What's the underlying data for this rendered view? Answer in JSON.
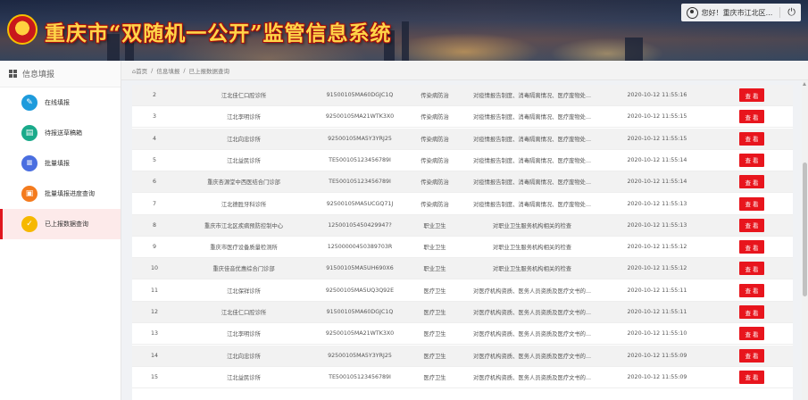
{
  "header": {
    "title": "重庆市“双随机一公开”监管信息系统",
    "user_greeting": "您好！重庆市江北区...",
    "user_icon": "user-icon",
    "logout_icon": "power-icon"
  },
  "sidebar": {
    "heading": "信息填报",
    "items": [
      {
        "label": "在线填报",
        "icon": "edit-icon",
        "color": "#1e9bdc"
      },
      {
        "label": "待报送草稿箱",
        "icon": "draft-icon",
        "color": "#1aaa8a"
      },
      {
        "label": "批量填报",
        "icon": "batch-icon",
        "color": "#4a6ee0"
      },
      {
        "label": "批量填报进度查询",
        "icon": "progress-icon",
        "color": "#f47b1e"
      },
      {
        "label": "已上报数据查询",
        "icon": "query-icon",
        "color": "#f6b800",
        "active": true
      }
    ]
  },
  "breadcrumb": [
    "⌂首页",
    "/",
    "信息填报",
    "/",
    "已上报数据查询"
  ],
  "table": {
    "view_label": "查 看",
    "rows": [
      {
        "no": "2",
        "name": "江北佳仁口腔诊所",
        "code": "91500105MA60DGJC1Q",
        "category": "传染病防治",
        "desc": "对疫情报告制度、消毒隔离情况、医疗废物处...",
        "time": "2020-10-12 11:55:16"
      },
      {
        "no": "3",
        "name": "江北李明诊所",
        "code": "92500105MA21WTK3X0",
        "category": "传染病防治",
        "desc": "对疫情报告制度、消毒隔离情况、医疗废物处...",
        "time": "2020-10-12 11:55:15"
      },
      {
        "no": "4",
        "name": "江北向忠诊所",
        "code": "92500105MA5Y3YRJ25",
        "category": "传染病防治",
        "desc": "对疫情报告制度、消毒隔离情况、医疗废物处...",
        "time": "2020-10-12 11:55:15"
      },
      {
        "no": "5",
        "name": "江北益民诊所",
        "code": "TE500105123456789I",
        "category": "传染病防治",
        "desc": "对疫情报告制度、消毒隔离情况、医疗废物处...",
        "time": "2020-10-12 11:55:14"
      },
      {
        "no": "6",
        "name": "重庆杏源堂中西医结合门诊部",
        "code": "TE500105123456789I",
        "category": "传染病防治",
        "desc": "对疫情报告制度、消毒隔离情况、医疗废物处...",
        "time": "2020-10-12 11:55:14"
      },
      {
        "no": "7",
        "name": "江北德胜牙科诊所",
        "code": "92500105MA5UCGQ71J",
        "category": "传染病防治",
        "desc": "对疫情报告制度、消毒隔离情况、医疗废物处...",
        "time": "2020-10-12 11:55:13"
      },
      {
        "no": "8",
        "name": "重庆市江北区疾病预防控制中心",
        "code": "12500105450429947?",
        "category": "职业卫生",
        "desc": "对职业卫生服务机构相关的检查",
        "time": "2020-10-12 11:55:13"
      },
      {
        "no": "9",
        "name": "重庆市医疗设备质量检测所",
        "code": "12500000450389703R",
        "category": "职业卫生",
        "desc": "对职业卫生服务机构相关的检查",
        "time": "2020-10-12 11:55:12"
      },
      {
        "no": "10",
        "name": "重庆佳音优惠综合门诊部",
        "code": "91500105MA5UH690X6",
        "category": "职业卫生",
        "desc": "对职业卫生服务机构相关的检查",
        "time": "2020-10-12 11:55:12"
      },
      {
        "no": "11",
        "name": "江北保祥诊所",
        "code": "92500105MA5UQ3Q92E",
        "category": "医疗卫生",
        "desc": "对医疗机构资质、医务人员资质及医疗文书的...",
        "time": "2020-10-12 11:55:11"
      },
      {
        "no": "12",
        "name": "江北佳仁口腔诊所",
        "code": "91500105MA60DGJC1Q",
        "category": "医疗卫生",
        "desc": "对医疗机构资质、医务人员资质及医疗文书的...",
        "time": "2020-10-12 11:55:11"
      },
      {
        "no": "13",
        "name": "江北李明诊所",
        "code": "92500105MA21WTK3X0",
        "category": "医疗卫生",
        "desc": "对医疗机构资质、医务人员资质及医疗文书的...",
        "time": "2020-10-12 11:55:10"
      },
      {
        "no": "14",
        "name": "江北向忠诊所",
        "code": "92500105MA5Y3YRJ25",
        "category": "医疗卫生",
        "desc": "对医疗机构资质、医务人员资质及医疗文书的...",
        "time": "2020-10-12 11:55:09"
      },
      {
        "no": "15",
        "name": "江北益民诊所",
        "code": "TE500105123456789I",
        "category": "医疗卫生",
        "desc": "对医疗机构资质、医务人员资质及医疗文书的...",
        "time": "2020-10-12 11:55:09"
      }
    ]
  },
  "colors": {
    "accent": "#e8151d",
    "title": "#ffd548",
    "active_bg": "#fdeaea"
  }
}
